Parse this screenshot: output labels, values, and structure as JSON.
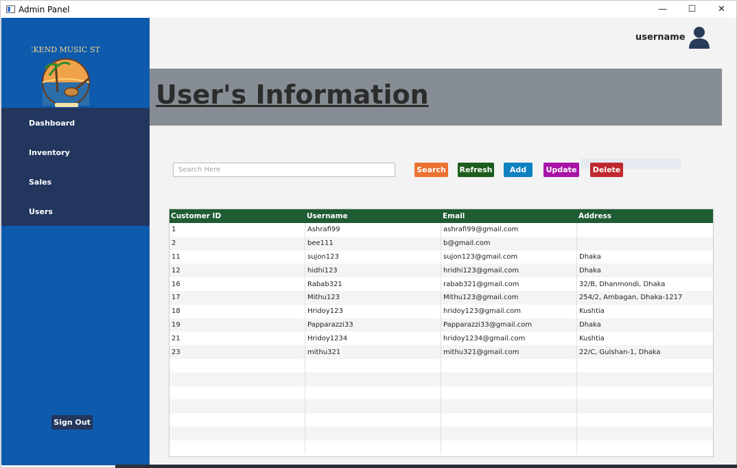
{
  "window": {
    "title": "Admin Panel",
    "controls": [
      "—",
      "☐",
      "✕"
    ]
  },
  "sidebar": {
    "logo_text": "WEEKEND MUSIC STORE",
    "items": [
      {
        "label": "Dashboard"
      },
      {
        "label": "Inventory"
      },
      {
        "label": "Sales"
      },
      {
        "label": "Users"
      }
    ],
    "signout_label": "Sign Out"
  },
  "header": {
    "username": "username"
  },
  "banner": {
    "title": "User's Information"
  },
  "toolbar": {
    "search_placeholder": "Search Here",
    "buttons": [
      {
        "label": "Search",
        "color": "#ec7232"
      },
      {
        "label": "Refresh",
        "color": "#1d5d1c"
      },
      {
        "label": "Add",
        "color": "#0e81c1"
      },
      {
        "label": "Update",
        "color": "#a814a8"
      },
      {
        "label": "Delete",
        "color": "#c0282f"
      }
    ]
  },
  "table": {
    "columns": [
      "Customer ID",
      "Username",
      "Email",
      "Address"
    ],
    "rows": [
      [
        "1",
        "Ashrafi99",
        "ashrafi99@gmail.com",
        ""
      ],
      [
        "2",
        "bee111",
        "b@gmail.com",
        ""
      ],
      [
        "11",
        "sujon123",
        "sujon123@gmail.com",
        "Dhaka"
      ],
      [
        "12",
        "hidhi123",
        "hridhi123@gmail.com",
        "Dhaka"
      ],
      [
        "16",
        "Rabab321",
        "rabab321@gmail.com",
        "32/B, Dhanmondi, Dhaka"
      ],
      [
        "17",
        "Mithu123",
        "Mithu123@gmail.com",
        "254/2, Ambagan, Dhaka-1217"
      ],
      [
        "18",
        "Hridoy123",
        "hridoy123@gmail.com",
        "Kushtia"
      ],
      [
        "19",
        "Papparazzi33",
        "Papparazzi33@gmail.com",
        "Dhaka"
      ],
      [
        "21",
        "Hridoy1234",
        "hridoy1234@gmail.com",
        "Kushtia"
      ],
      [
        "23",
        "mithu321",
        "mithu321@gmail.com",
        "22/C, Gulshan-1, Dhaka"
      ],
      [
        "",
        "",
        "",
        ""
      ],
      [
        "",
        "",
        "",
        ""
      ],
      [
        "",
        "",
        "",
        ""
      ],
      [
        "",
        "",
        "",
        ""
      ],
      [
        "",
        "",
        "",
        ""
      ],
      [
        "",
        "",
        "",
        ""
      ],
      [
        "",
        "",
        "",
        ""
      ]
    ]
  },
  "colors": {
    "sidebar": "#0e5aad",
    "nav": "#22365e",
    "banner": "#878d94",
    "table_header": "#1f5c33"
  }
}
